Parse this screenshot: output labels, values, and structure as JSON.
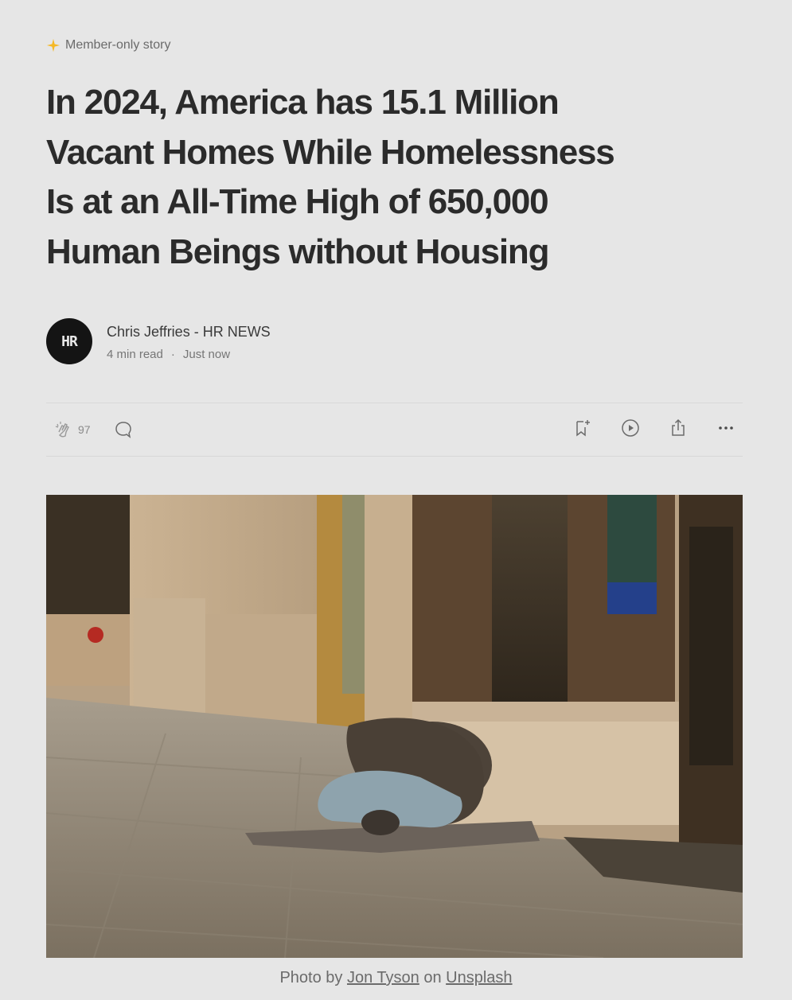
{
  "badge": {
    "label": "Member-only story",
    "icon": "star-icon",
    "accent": "#f5b825"
  },
  "article": {
    "title_lines": [
      "In 2024, America has 15.1 Million",
      "Vacant Homes While Homelessness",
      "Is at an All-Time High of 650,000",
      "Human Beings without Housing"
    ]
  },
  "author": {
    "avatar_text": "HR",
    "name": "Chris Jeffries - HR NEWS",
    "read_time": "4 min read",
    "separator": "·",
    "published": "Just now"
  },
  "actions": {
    "clap_count": "97",
    "icons": [
      "clap-icon",
      "comment-icon",
      "bookmark-add-icon",
      "play-icon",
      "share-icon",
      "more-icon"
    ]
  },
  "hero": {
    "description_icon": "photo"
  },
  "caption": {
    "prefix": "Photo by",
    "author": "Jon Tyson",
    "on": "on",
    "source": "Unsplash"
  }
}
